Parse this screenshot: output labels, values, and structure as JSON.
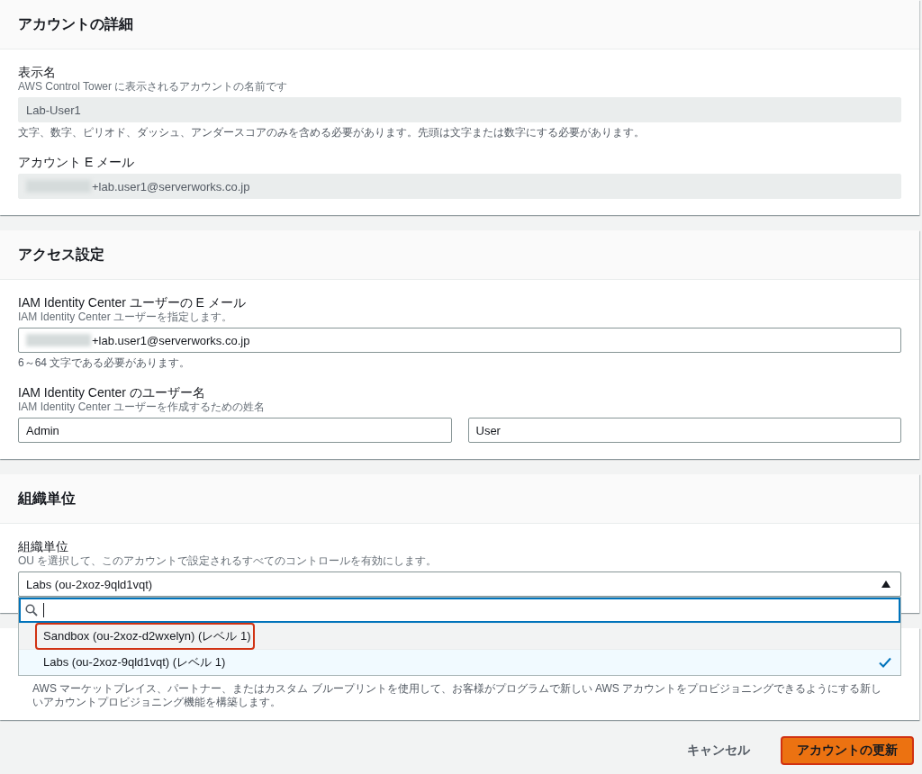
{
  "panels": [
    {
      "title": "アカウントの詳細",
      "fields": [
        {
          "kind": "text",
          "label": "表示名",
          "description": "AWS Control Tower に表示されるアカウントの名前です",
          "inputs": [
            {
              "value": "Lab-User1",
              "disabled": true,
              "redacted": false
            }
          ],
          "constraint": "文字、数字、ピリオド、ダッシュ、アンダースコアのみを含める必要があります。先頭は文字または数字にする必要があります。"
        },
        {
          "kind": "text",
          "label": "アカウント E メール",
          "inputs": [
            {
              "value": "+lab.user1@serverworks.co.jp",
              "disabled": true,
              "redacted": true
            }
          ]
        }
      ]
    },
    {
      "title": "アクセス設定",
      "fields": [
        {
          "kind": "text",
          "label": "IAM Identity Center ユーザーの E メール",
          "description": "IAM Identity Center ユーザーを指定します。",
          "inputs": [
            {
              "value": "+lab.user1@serverworks.co.jp",
              "disabled": false,
              "redacted": true
            }
          ],
          "constraint": "6～64 文字である必要があります。"
        },
        {
          "kind": "text",
          "label": "IAM Identity Center のユーザー名",
          "description": "IAM Identity Center ユーザーを作成するための姓名",
          "inputs": [
            {
              "value": "Admin",
              "disabled": false,
              "redacted": false
            },
            {
              "value": "User",
              "disabled": false,
              "redacted": false
            }
          ]
        }
      ]
    },
    {
      "title": "組織単位",
      "fields": [
        {
          "kind": "select",
          "label": "組織単位",
          "description": "OU を選択して、このアカウントで設定されるすべてのコントロールを有効にします。",
          "value": "Labs (ou-2xoz-9qld1vqt)",
          "expanded": true,
          "options": [
            {
              "label": "Sandbox (ou-2xoz-d2wxelyn) (レベル 1)",
              "selected": false,
              "annotated": true
            },
            {
              "label": "Labs (ou-2xoz-9qld1vqt) (レベル 1)",
              "selected": true,
              "annotated": false
            }
          ]
        }
      ]
    },
    {
      "body_text": "AWS マーケットプレイス、パートナー、またはカスタム ブループリントを使用して、お客様がプログラムで新しい AWS アカウントをプロビジョニングできるようにする新しいアカウントプロビジョニング機能を構築します。"
    }
  ],
  "footer": {
    "cancel": "キャンセル",
    "submit": {
      "label": "アカウントの更新",
      "annotated": true
    }
  }
}
